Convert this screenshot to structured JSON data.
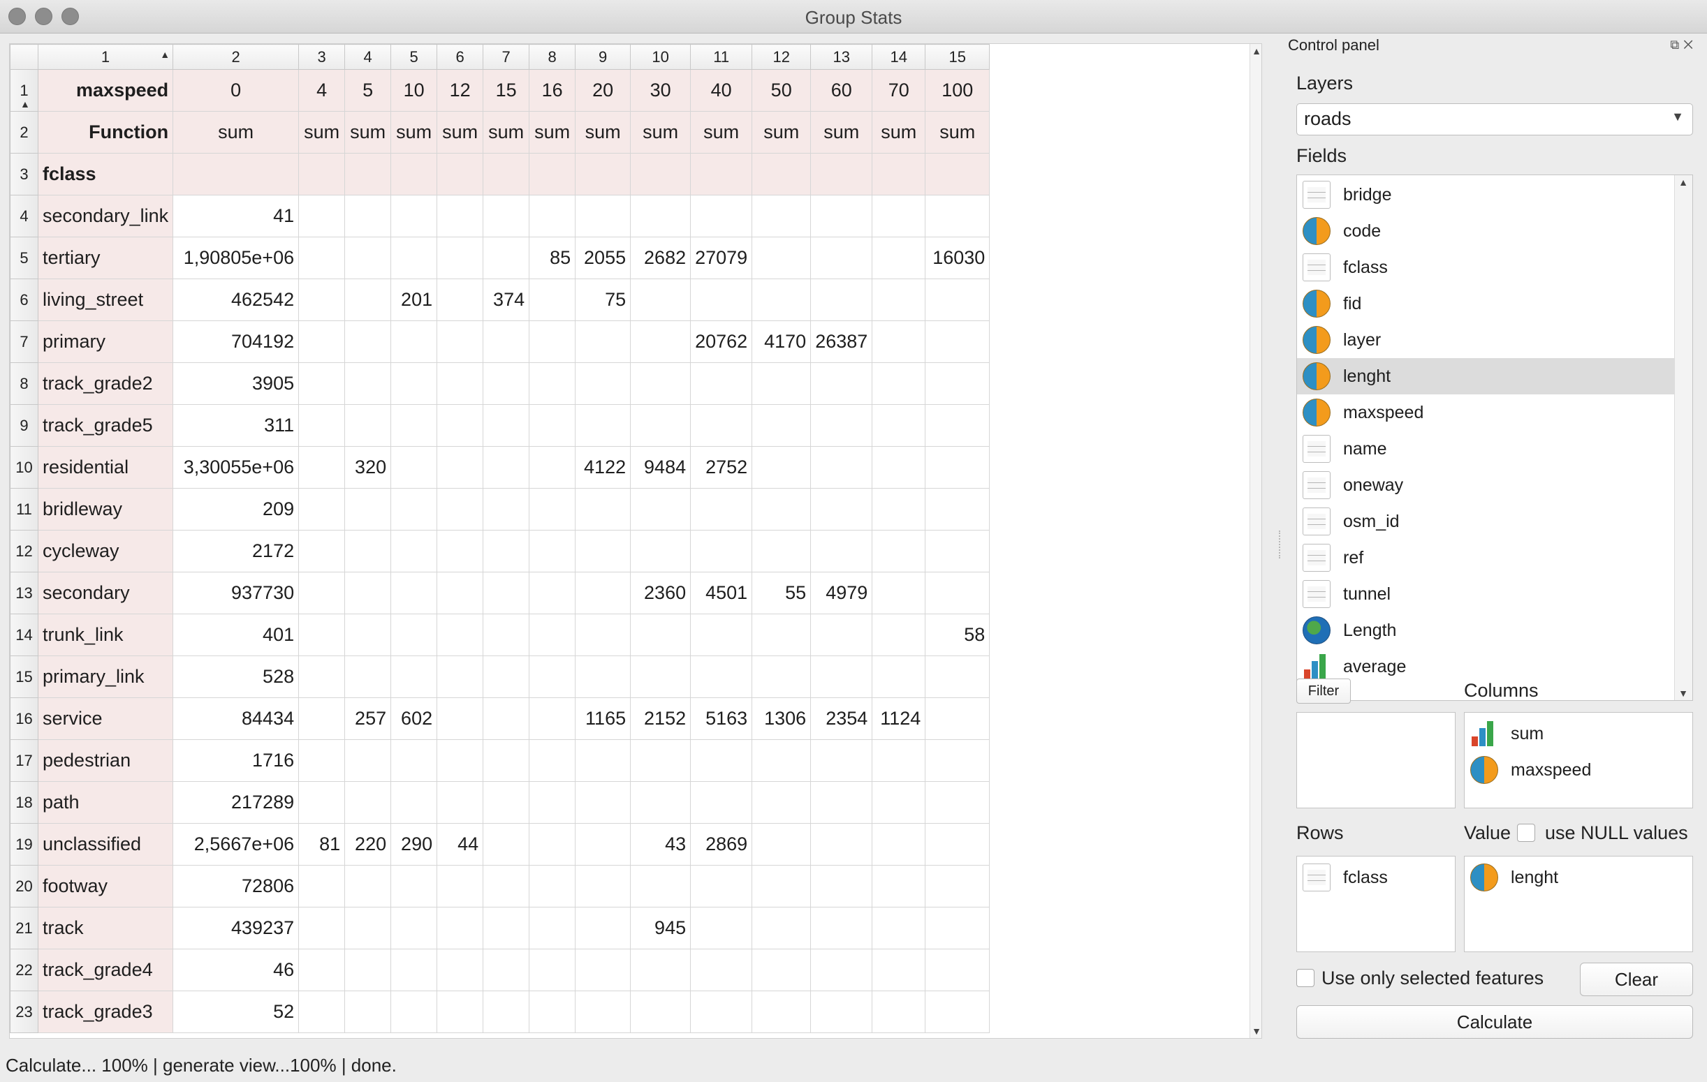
{
  "window": {
    "title": "Group Stats"
  },
  "table": {
    "column_headers": [
      "1",
      "2",
      "3",
      "4",
      "5",
      "6",
      "7",
      "8",
      "9",
      "10",
      "11",
      "12",
      "13",
      "14",
      "15"
    ],
    "row_headers": [
      "1",
      "2",
      "3",
      "4",
      "5",
      "6",
      "7",
      "8",
      "9",
      "10",
      "11",
      "12",
      "13",
      "14",
      "15",
      "16",
      "17",
      "18",
      "19",
      "20",
      "21",
      "22",
      "23"
    ],
    "header_row_label": "maxspeed",
    "header_row_values": [
      "0",
      "4",
      "5",
      "10",
      "12",
      "15",
      "16",
      "20",
      "30",
      "40",
      "50",
      "60",
      "70",
      "100"
    ],
    "function_label": "Function",
    "function_values": [
      "sum",
      "sum",
      "sum",
      "sum",
      "sum",
      "sum",
      "sum",
      "sum",
      "sum",
      "sum",
      "sum",
      "sum",
      "sum",
      "sum"
    ],
    "group_label": "fclass",
    "rows": [
      {
        "name": "secondary_link",
        "cells": [
          "41",
          "",
          "",
          "",
          "",
          "",
          "",
          "",
          "",
          "",
          "",
          "",
          "",
          ""
        ]
      },
      {
        "name": "tertiary",
        "cells": [
          "1,90805e+06",
          "",
          "",
          "",
          "",
          "",
          "85",
          "2055",
          "2682",
          "27079",
          "",
          "",
          "",
          "16030"
        ]
      },
      {
        "name": "living_street",
        "cells": [
          "462542",
          "",
          "",
          "201",
          "",
          "374",
          "",
          "75",
          "",
          "",
          "",
          "",
          "",
          ""
        ]
      },
      {
        "name": "primary",
        "cells": [
          "704192",
          "",
          "",
          "",
          "",
          "",
          "",
          "",
          "",
          "20762",
          "4170",
          "26387",
          "",
          ""
        ]
      },
      {
        "name": "track_grade2",
        "cells": [
          "3905",
          "",
          "",
          "",
          "",
          "",
          "",
          "",
          "",
          "",
          "",
          "",
          "",
          ""
        ]
      },
      {
        "name": "track_grade5",
        "cells": [
          "311",
          "",
          "",
          "",
          "",
          "",
          "",
          "",
          "",
          "",
          "",
          "",
          "",
          ""
        ]
      },
      {
        "name": "residential",
        "cells": [
          "3,30055e+06",
          "",
          "320",
          "",
          "",
          "",
          "",
          "4122",
          "9484",
          "2752",
          "",
          "",
          "",
          ""
        ]
      },
      {
        "name": "bridleway",
        "cells": [
          "209",
          "",
          "",
          "",
          "",
          "",
          "",
          "",
          "",
          "",
          "",
          "",
          "",
          ""
        ]
      },
      {
        "name": "cycleway",
        "cells": [
          "2172",
          "",
          "",
          "",
          "",
          "",
          "",
          "",
          "",
          "",
          "",
          "",
          "",
          ""
        ]
      },
      {
        "name": "secondary",
        "cells": [
          "937730",
          "",
          "",
          "",
          "",
          "",
          "",
          "",
          "2360",
          "4501",
          "55",
          "4979",
          "",
          ""
        ]
      },
      {
        "name": "trunk_link",
        "cells": [
          "401",
          "",
          "",
          "",
          "",
          "",
          "",
          "",
          "",
          "",
          "",
          "",
          "",
          "58"
        ]
      },
      {
        "name": "primary_link",
        "cells": [
          "528",
          "",
          "",
          "",
          "",
          "",
          "",
          "",
          "",
          "",
          "",
          "",
          "",
          ""
        ]
      },
      {
        "name": "service",
        "cells": [
          "84434",
          "",
          "257",
          "602",
          "",
          "",
          "",
          "1165",
          "2152",
          "5163",
          "1306",
          "2354",
          "1124",
          ""
        ]
      },
      {
        "name": "pedestrian",
        "cells": [
          "1716",
          "",
          "",
          "",
          "",
          "",
          "",
          "",
          "",
          "",
          "",
          "",
          "",
          ""
        ]
      },
      {
        "name": "path",
        "cells": [
          "217289",
          "",
          "",
          "",
          "",
          "",
          "",
          "",
          "",
          "",
          "",
          "",
          "",
          ""
        ]
      },
      {
        "name": "unclassified",
        "cells": [
          "2,5667e+06",
          "81",
          "220",
          "290",
          "44",
          "",
          "",
          "",
          "43",
          "2869",
          "",
          "",
          "",
          ""
        ]
      },
      {
        "name": "footway",
        "cells": [
          "72806",
          "",
          "",
          "",
          "",
          "",
          "",
          "",
          "",
          "",
          "",
          "",
          "",
          ""
        ]
      },
      {
        "name": "track",
        "cells": [
          "439237",
          "",
          "",
          "",
          "",
          "",
          "",
          "",
          "945",
          "",
          "",
          "",
          "",
          ""
        ]
      },
      {
        "name": "track_grade4",
        "cells": [
          "46",
          "",
          "",
          "",
          "",
          "",
          "",
          "",
          "",
          "",
          "",
          "",
          "",
          ""
        ]
      },
      {
        "name": "track_grade3",
        "cells": [
          "52",
          "",
          "",
          "",
          "",
          "",
          "",
          "",
          "",
          "",
          "",
          "",
          "",
          ""
        ]
      }
    ]
  },
  "panel": {
    "title": "Control panel",
    "layers_label": "Layers",
    "layer_selected": "roads",
    "fields_label": "Fields",
    "fields": [
      {
        "name": "bridge",
        "icon": "text-field-icon"
      },
      {
        "name": "code",
        "icon": "numeric-field-icon"
      },
      {
        "name": "fclass",
        "icon": "text-field-icon"
      },
      {
        "name": "fid",
        "icon": "numeric-field-icon"
      },
      {
        "name": "layer",
        "icon": "numeric-field-icon"
      },
      {
        "name": "lenght",
        "icon": "numeric-field-icon",
        "selected": true
      },
      {
        "name": "maxspeed",
        "icon": "numeric-field-icon"
      },
      {
        "name": "name",
        "icon": "text-field-icon"
      },
      {
        "name": "oneway",
        "icon": "text-field-icon"
      },
      {
        "name": "osm_id",
        "icon": "text-field-icon"
      },
      {
        "name": "ref",
        "icon": "text-field-icon"
      },
      {
        "name": "tunnel",
        "icon": "text-field-icon"
      },
      {
        "name": "Length",
        "icon": "geometry-field-icon"
      },
      {
        "name": "average",
        "icon": "function-icon"
      }
    ],
    "filter_label": "Filter",
    "columns_label": "Columns",
    "columns_items": [
      {
        "name": "sum",
        "icon": "function-icon"
      },
      {
        "name": "maxspeed",
        "icon": "numeric-field-icon"
      }
    ],
    "rows_label": "Rows",
    "rows_items": [
      {
        "name": "fclass",
        "icon": "text-field-icon"
      }
    ],
    "value_label": "Value",
    "use_null_label": "use NULL values",
    "value_items": [
      {
        "name": "lenght",
        "icon": "numeric-field-icon"
      }
    ],
    "selected_only_label": "Use only selected features",
    "clear_label": "Clear",
    "calculate_label": "Calculate"
  },
  "status": {
    "text": "Calculate... 100% |  generate view...100% |  done."
  },
  "colors": {
    "header_cell_bg": "#f6e9e8",
    "selected_field_bg": "#dcdcdc"
  }
}
